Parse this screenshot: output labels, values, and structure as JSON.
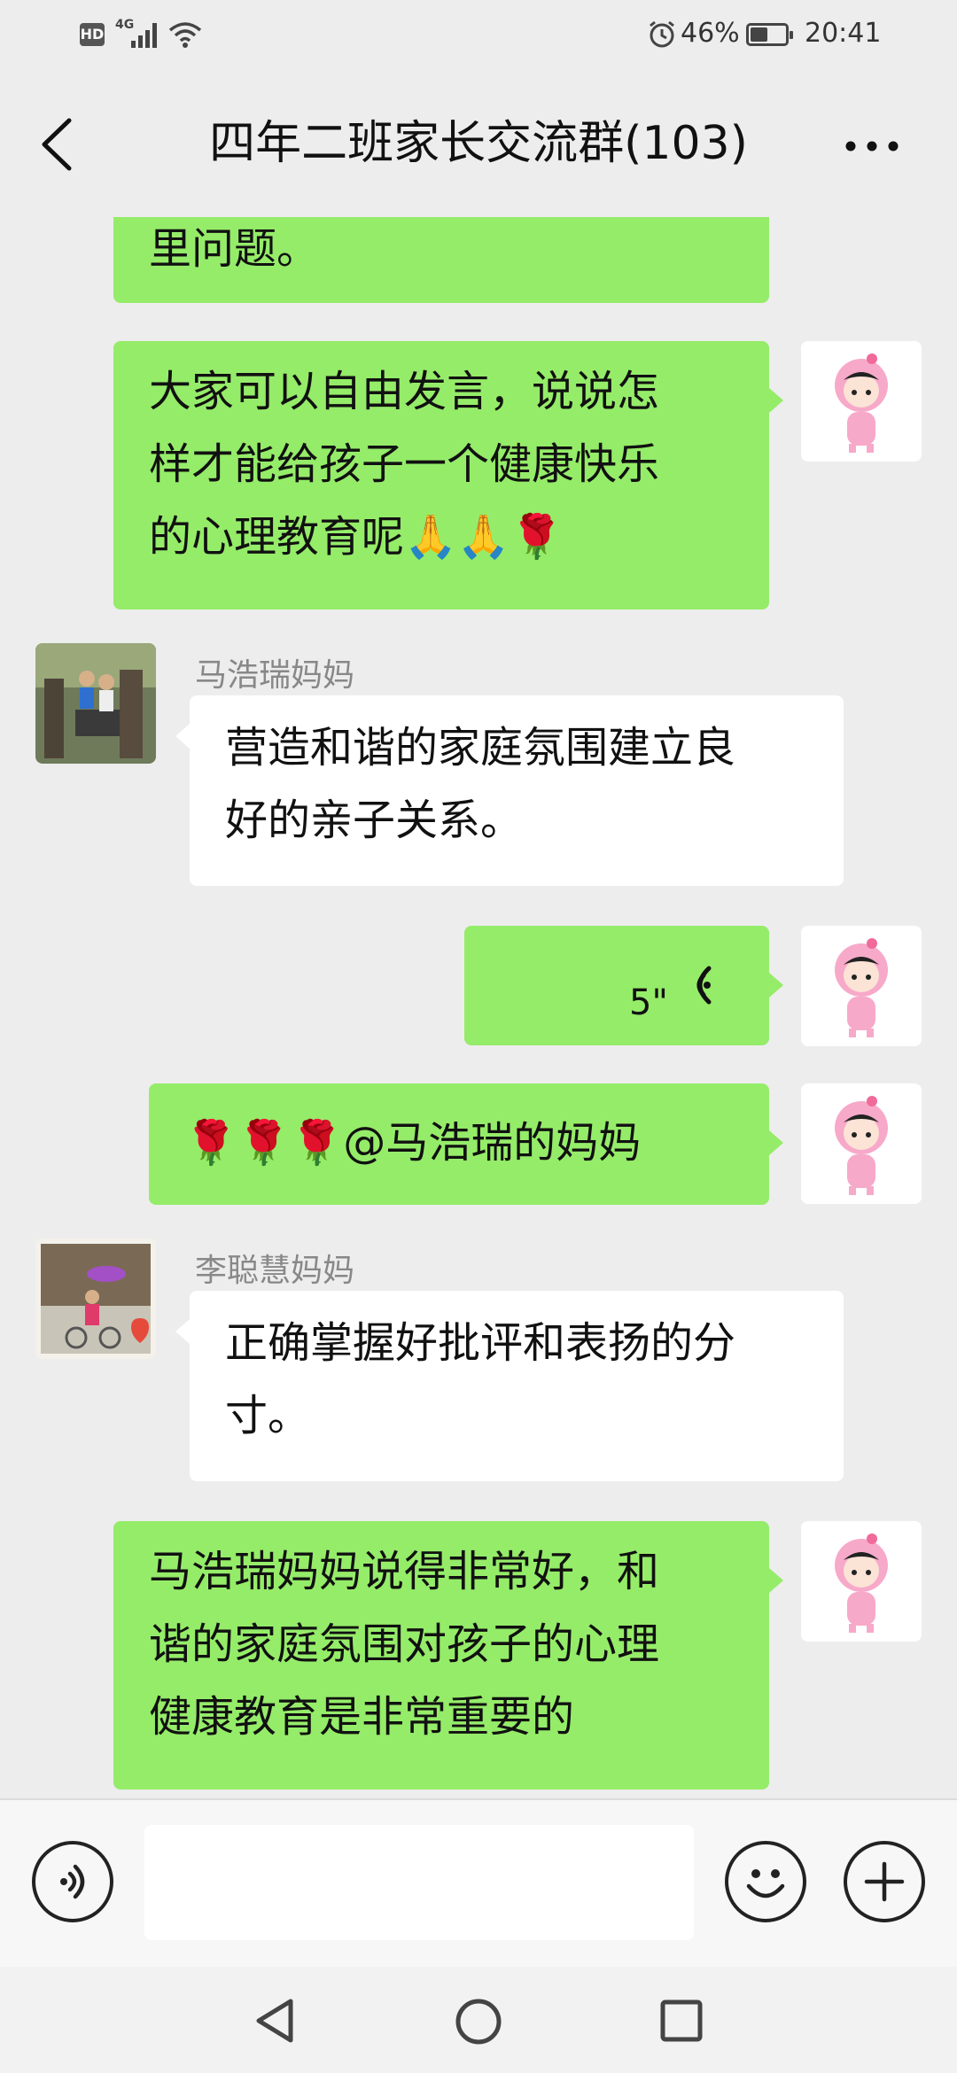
{
  "status_bar": {
    "hd": "HD",
    "network": "4G",
    "battery_percent": "46%",
    "time": "20:41"
  },
  "header": {
    "title": "四年二班家长交流群(103)"
  },
  "messages": [
    {
      "type": "text",
      "side": "right",
      "text_lines": [
        "里问题。"
      ]
    },
    {
      "type": "text",
      "side": "right",
      "text_lines": [
        "大家可以自由发言，说说怎",
        "样才能给孩子一个健康快乐",
        "的心理教育呢🙏🙏🌹"
      ]
    },
    {
      "type": "text",
      "side": "left",
      "sender": "马浩瑞妈妈",
      "text_lines": [
        "营造和谐的家庭氛围建立良",
        "好的亲子关系。"
      ]
    },
    {
      "type": "voice",
      "side": "right",
      "duration": "5\""
    },
    {
      "type": "text",
      "side": "right",
      "text_lines": [
        "🌹🌹🌹@马浩瑞的妈妈"
      ]
    },
    {
      "type": "text",
      "side": "left",
      "sender": "李聪慧妈妈",
      "text_lines": [
        "正确掌握好批评和表扬的分",
        "寸。"
      ]
    },
    {
      "type": "text",
      "side": "right",
      "text_lines": [
        "马浩瑞妈妈说得非常好，和",
        "谐的家庭氛围对孩子的心理",
        "健康教育是非常重要的"
      ]
    }
  ],
  "icons": {
    "back": "chevron-left-icon",
    "more": "more-dots-icon",
    "voice_mode": "voice-icon",
    "emoji": "emoji-icon",
    "add": "plus-icon"
  },
  "colors": {
    "sent_bubble": "#95ec69",
    "received_bubble": "#ffffff",
    "background": "#ededed"
  }
}
